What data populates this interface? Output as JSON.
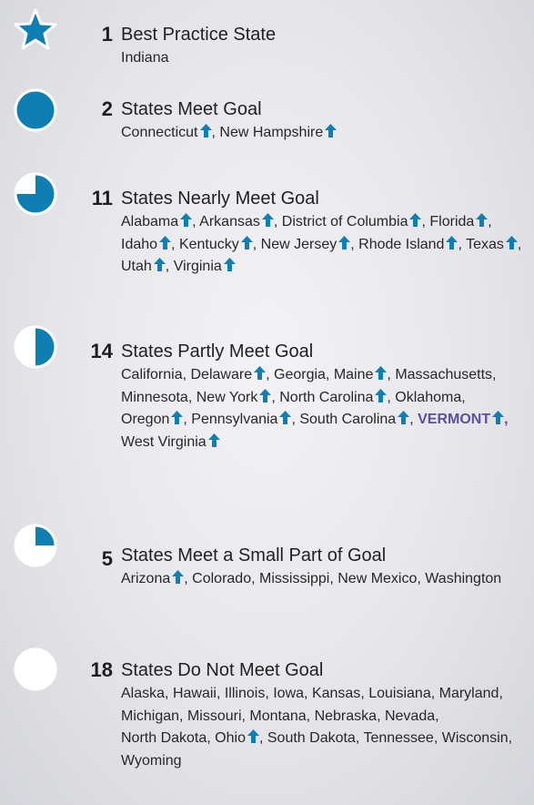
{
  "colors": {
    "accent": "#0f7fb3",
    "highlight": "#5c4f9e",
    "ring": "#ffffff"
  },
  "groups": [
    {
      "count": "1",
      "label": "Best Practice State",
      "icon": "star-icon",
      "states": [
        {
          "name": "Indiana",
          "up": false
        }
      ]
    },
    {
      "count": "2",
      "label": "States Meet Goal",
      "icon": "full-circle-icon",
      "states": [
        {
          "name": "Connecticut",
          "up": true
        },
        {
          "name": "New Hampshire",
          "up": true
        }
      ]
    },
    {
      "count": "11",
      "label": "States Nearly Meet Goal",
      "icon": "three-quarter-circle-icon",
      "fill": 0.75,
      "states": [
        {
          "name": "Alabama",
          "up": true
        },
        {
          "name": "Arkansas",
          "up": true
        },
        {
          "name": "District of Columbia",
          "up": true
        },
        {
          "name": "Florida",
          "up": true
        },
        {
          "name": "Idaho",
          "up": true
        },
        {
          "name": "Kentucky",
          "up": true
        },
        {
          "name": "New Jersey",
          "up": true
        },
        {
          "name": "Rhode Island",
          "up": true
        },
        {
          "name": "Texas",
          "up": true
        },
        {
          "name": "Utah",
          "up": true
        },
        {
          "name": "Virginia",
          "up": true
        }
      ]
    },
    {
      "count": "14",
      "label": "States Partly Meet Goal",
      "icon": "half-circle-icon",
      "fill": 0.5,
      "states": [
        {
          "name": "California",
          "up": false
        },
        {
          "name": "Delaware",
          "up": true
        },
        {
          "name": "Georgia",
          "up": false
        },
        {
          "name": "Maine",
          "up": true
        },
        {
          "name": "Massachusetts",
          "up": false
        },
        {
          "name": "Minnesota",
          "up": false
        },
        {
          "name": "New York",
          "up": true
        },
        {
          "name": "North Carolina",
          "up": true
        },
        {
          "name": "Oklahoma",
          "up": false
        },
        {
          "name": "Oregon",
          "up": true
        },
        {
          "name": "Pennsylvania",
          "up": true
        },
        {
          "name": "South Carolina",
          "up": true
        },
        {
          "name": "VERMONT",
          "up": true,
          "highlight": true
        },
        {
          "name": "West Virginia",
          "up": true
        }
      ]
    },
    {
      "count": "5",
      "label": "States Meet a Small Part of Goal",
      "icon": "quarter-circle-icon",
      "fill": 0.25,
      "states": [
        {
          "name": "Arizona",
          "up": true
        },
        {
          "name": "Colorado",
          "up": false
        },
        {
          "name": "Mississippi",
          "up": false
        },
        {
          "name": "New Mexico",
          "up": false
        },
        {
          "name": "Washington",
          "up": false
        }
      ]
    },
    {
      "count": "18",
      "label": "States Do Not Meet Goal",
      "icon": "empty-circle-icon",
      "fill": 0,
      "states": [
        {
          "name": "Alaska",
          "up": false
        },
        {
          "name": "Hawaii",
          "up": false
        },
        {
          "name": "Illinois",
          "up": false
        },
        {
          "name": "Iowa",
          "up": false
        },
        {
          "name": "Kansas",
          "up": false
        },
        {
          "name": "Louisiana",
          "up": false
        },
        {
          "name": "Maryland",
          "up": false
        },
        {
          "name": "Michigan",
          "up": false
        },
        {
          "name": "Missouri",
          "up": false
        },
        {
          "name": "Montana",
          "up": false
        },
        {
          "name": "Nebraska",
          "up": false
        },
        {
          "name": "Nevada",
          "up": false
        },
        {
          "name": "North Dakota",
          "up": false
        },
        {
          "name": "Ohio",
          "up": true
        },
        {
          "name": "South Dakota",
          "up": false
        },
        {
          "name": "Tennessee",
          "up": false
        },
        {
          "name": "Wisconsin",
          "up": false
        },
        {
          "name": "Wyoming",
          "up": false
        }
      ]
    }
  ]
}
